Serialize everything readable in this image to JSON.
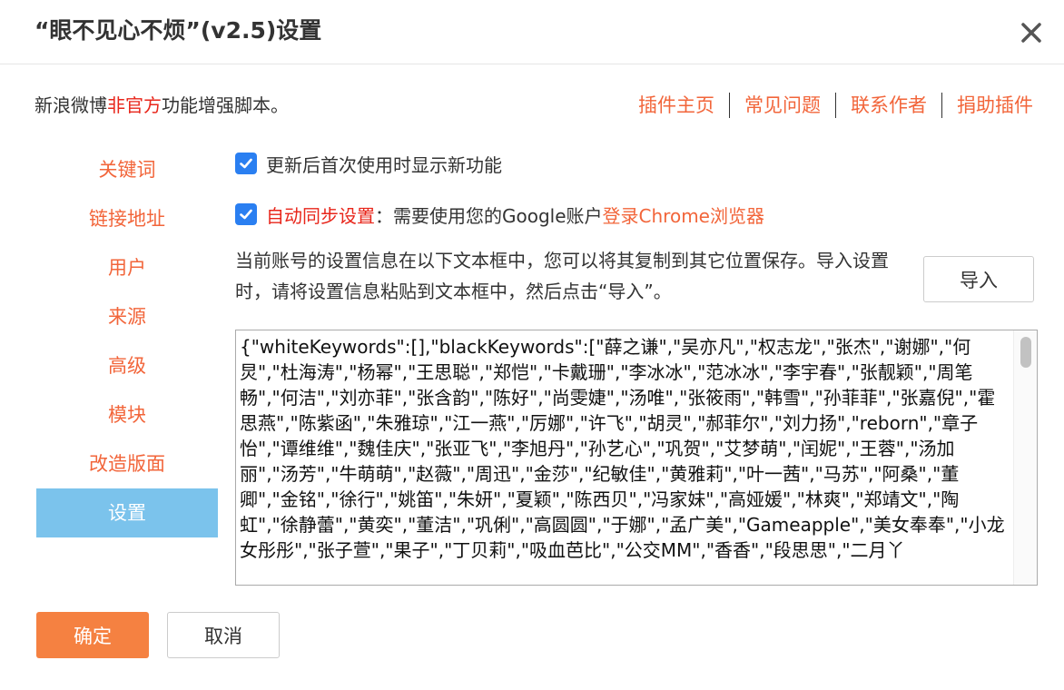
{
  "dialog": {
    "title": "“眼不见心不烦”(v2.5)设置",
    "close_icon": "close-icon"
  },
  "intro": {
    "prefix": "新浪微博",
    "highlight": "非官方",
    "suffix": "功能增强脚本。"
  },
  "top_links": [
    {
      "label": "插件主页"
    },
    {
      "label": "常见问题"
    },
    {
      "label": "联系作者"
    },
    {
      "label": "捐助插件"
    }
  ],
  "sidebar": {
    "items": [
      {
        "label": "关键词",
        "active": false
      },
      {
        "label": "链接地址",
        "active": false
      },
      {
        "label": "用户",
        "active": false
      },
      {
        "label": "来源",
        "active": false
      },
      {
        "label": "高级",
        "active": false
      },
      {
        "label": "模块",
        "active": false
      },
      {
        "label": "改造版面",
        "active": false
      },
      {
        "label": "设置",
        "active": true
      }
    ]
  },
  "settings": {
    "show_new_features": {
      "label": "更新后首次使用时显示新功能",
      "checked": true
    },
    "auto_sync": {
      "label": "自动同步设置",
      "desc": "：需要使用您的Google账户",
      "link": "登录Chrome浏览器",
      "checked": true
    },
    "description": "当前账号的设置信息在以下文本框中，您可以将其复制到其它位置保存。导入设置时，请将设置信息粘贴到文本框中，然后点击“导入”。",
    "import_label": "导入",
    "settings_text": "{\"whiteKeywords\":[],\"blackKeywords\":[\"薛之谦\",\"吴亦凡\",\"权志龙\",\"张杰\",\"谢娜\",\"何炅\",\"杜海涛\",\"杨幂\",\"王思聪\",\"郑恺\",\"卡戴珊\",\"李冰冰\",\"范冰冰\",\"李宇春\",\"张靓颖\",\"周笔畅\",\"何洁\",\"刘亦菲\",\"张含韵\",\"陈好\",\"尚雯婕\",\"汤唯\",\"张筱雨\",\"韩雪\",\"孙菲菲\",\"张嘉倪\",\"霍思燕\",\"陈紫函\",\"朱雅琼\",\"江一燕\",\"厉娜\",\"许飞\",\"胡灵\",\"郝菲尔\",\"刘力扬\",\"reborn\",\"章子怡\",\"谭维维\",\"魏佳庆\",\"张亚飞\",\"李旭丹\",\"孙艺心\",\"巩贺\",\"艾梦萌\",\"闰妮\",\"王蓉\",\"汤加丽\",\"汤芳\",\"牛萌萌\",\"赵薇\",\"周迅\",\"金莎\",\"纪敏佳\",\"黄雅莉\",\"叶一茜\",\"马苏\",\"阿桑\",\"董卿\",\"金铭\",\"徐行\",\"姚笛\",\"朱妍\",\"夏颖\",\"陈西贝\",\"冯家妹\",\"高娅媛\",\"林爽\",\"郑靖文\",\"陶虹\",\"徐静蕾\",\"黄奕\",\"董洁\",\"巩俐\",\"高圆圆\",\"于娜\",\"孟广美\",\"Gameapple\",\"美女奉奉\",\"小龙女彤彤\",\"张子萱\",\"果子\",\"丁贝莉\",\"吸血芭比\",\"公交MM\",\"香香\",\"段思思\",\"二月丫"
  },
  "footer": {
    "ok_label": "确定",
    "cancel_label": "取消"
  },
  "colors": {
    "accent_orange": "#f2653a",
    "highlight_red": "#e8251a",
    "active_nav_bg": "#7bc3ec",
    "ok_button_bg": "#f58141",
    "checkbox_blue": "#2a7ff1"
  }
}
